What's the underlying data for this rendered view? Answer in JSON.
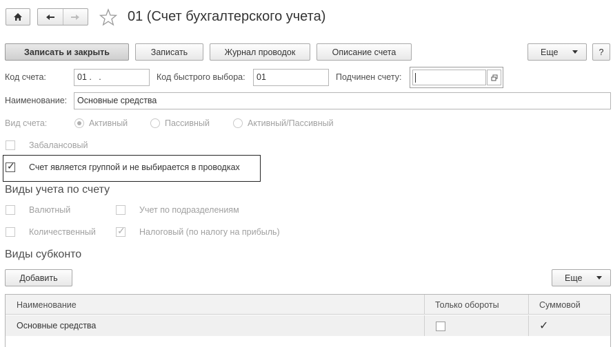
{
  "window": {
    "title": "01 (Счет бухгалтерского учета)"
  },
  "toolbar": {
    "save_close": "Записать и закрыть",
    "save": "Записать",
    "journal": "Журнал проводок",
    "description": "Описание счета",
    "more": "Еще",
    "help": "?"
  },
  "fields": {
    "code_label": "Код счета:",
    "code_value": "01 .   .",
    "quick_label": "Код быстрого выбора:",
    "quick_value": "01",
    "parent_label": "Подчинен счету:",
    "parent_value": "",
    "name_label": "Наименование:",
    "name_value": "Основные средства"
  },
  "account_type": {
    "label": "Вид счета:",
    "options": [
      "Активный",
      "Пассивный",
      "Активный/Пассивный"
    ],
    "selected": "Активный"
  },
  "checkboxes": {
    "offbalance": "Забалансовый",
    "is_group": "Счет является группой и не выбирается в проводках"
  },
  "accounting": {
    "title": "Виды учета по счету",
    "currency": "Валютный",
    "divisions": "Учет по подразделениям",
    "quantity": "Количественный",
    "tax": "Налоговый (по налогу на прибыль)"
  },
  "subconto": {
    "title": "Виды субконто",
    "add": "Добавить",
    "more": "Еще",
    "columns": [
      "Наименование",
      "Только обороты",
      "Суммовой"
    ],
    "rows": [
      {
        "name": "Основные средства",
        "turnover_only": false,
        "sum": true
      }
    ]
  }
}
